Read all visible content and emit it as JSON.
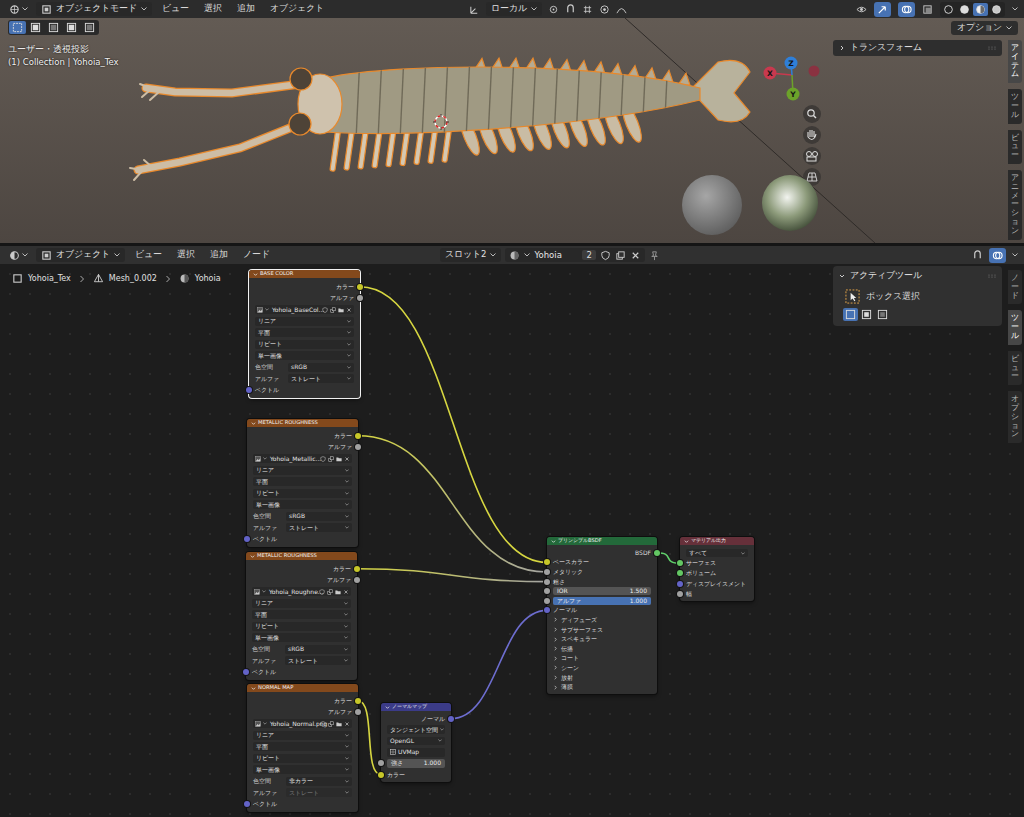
{
  "viewport_header": {
    "mode": "オブジェクトモード",
    "menus": [
      "ビュー",
      "選択",
      "追加",
      "オブジェクト"
    ],
    "orientation": "ローカル",
    "gizmos_on": true,
    "overlays_on": true,
    "shading_modes": [
      {
        "selected": false
      },
      {
        "selected": false
      },
      {
        "selected": true
      },
      {
        "selected": false
      }
    ]
  },
  "viewport": {
    "view_name": "ユーザー・透視投影",
    "collection": "(1) Collection | Yohoia_Tex",
    "options_button": "オプション",
    "select_modes": [
      {
        "selected": true
      },
      {
        "selected": false
      },
      {
        "selected": false
      },
      {
        "selected": false
      },
      {
        "selected": false
      }
    ],
    "transform_panel": {
      "title": "トランスフォーム",
      "expanded": false
    },
    "tabs": [
      {
        "label": "アイテム",
        "selected": true
      },
      {
        "label": "ツール",
        "selected": false
      },
      {
        "label": "ビュー",
        "selected": false
      },
      {
        "label": "アニメーション",
        "selected": false
      }
    ],
    "gizmo_axes": [
      {
        "label": "X",
        "color": "#c8394e"
      },
      {
        "label": "Y",
        "color": "#6ca22a"
      },
      {
        "label": "Z",
        "color": "#2f7fd8"
      }
    ]
  },
  "node_header": {
    "mode": "オブジェクト",
    "menus": [
      "ビュー",
      "選択",
      "追加",
      "ノード"
    ],
    "slot": "スロット2",
    "material": "Yohoia",
    "users": "2",
    "overlay_on": true
  },
  "breadcrumb": [
    "Yohoia_Tex",
    "Mesh_0.002",
    "Yohoia"
  ],
  "active_tool": {
    "title": "アクティブツール",
    "tool": "ボックス選択",
    "expanded": true,
    "modes": [
      {
        "selected": true
      },
      {
        "selected": false
      },
      {
        "selected": false
      }
    ]
  },
  "sidebar_tabs": [
    {
      "label": "ノード",
      "selected": false
    },
    {
      "label": "ツール",
      "selected": true
    },
    {
      "label": "ビュー",
      "selected": false
    },
    {
      "label": "オプション",
      "selected": false
    }
  ],
  "nodes": [
    {
      "title": "BASE COLOR",
      "kind": "image",
      "selected": true,
      "rows": [
        {
          "kind": "output",
          "label": "カラー",
          "socket": "color"
        },
        {
          "kind": "output",
          "label": "アルファ",
          "socket": "float"
        },
        {
          "kind": "image",
          "value": "Yohoia_BaseCol..."
        },
        {
          "kind": "dropdown",
          "value": "リニア",
          "disabled": false
        },
        {
          "kind": "dropdown",
          "value": "平面",
          "disabled": false
        },
        {
          "kind": "dropdown",
          "value": "リピート",
          "disabled": false
        },
        {
          "kind": "dropdown",
          "value": "単一画像",
          "disabled": false
        },
        {
          "kind": "dropdown",
          "label": "色空間",
          "value": "sRGB",
          "disabled": false
        },
        {
          "kind": "dropdown",
          "label": "アルファ",
          "value": "ストレート",
          "disabled": false
        },
        {
          "kind": "input",
          "label": "ベクトル",
          "socket": "vector"
        }
      ]
    },
    {
      "title": "METALLIC ROUGHNESS",
      "kind": "image",
      "selected": false,
      "rows": [
        {
          "kind": "output",
          "label": "カラー",
          "socket": "color"
        },
        {
          "kind": "output",
          "label": "アルファ",
          "socket": "float"
        },
        {
          "kind": "image",
          "value": "Yohoia_Metallic..."
        },
        {
          "kind": "dropdown",
          "value": "リニア",
          "disabled": false
        },
        {
          "kind": "dropdown",
          "value": "平面",
          "disabled": false
        },
        {
          "kind": "dropdown",
          "value": "リピート",
          "disabled": false
        },
        {
          "kind": "dropdown",
          "value": "単一画像",
          "disabled": false
        },
        {
          "kind": "dropdown",
          "label": "色空間",
          "value": "sRGB",
          "disabled": false
        },
        {
          "kind": "dropdown",
          "label": "アルファ",
          "value": "ストレート",
          "disabled": false
        },
        {
          "kind": "input",
          "label": "ベクトル",
          "socket": "vector"
        }
      ]
    },
    {
      "title": "METALLIC ROUGHNESS",
      "kind": "image",
      "selected": false,
      "rows": [
        {
          "kind": "output",
          "label": "カラー",
          "socket": "color"
        },
        {
          "kind": "output",
          "label": "アルファ",
          "socket": "float"
        },
        {
          "kind": "image",
          "value": "Yohoia_Roughne..."
        },
        {
          "kind": "dropdown",
          "value": "リニア",
          "disabled": false
        },
        {
          "kind": "dropdown",
          "value": "平面",
          "disabled": false
        },
        {
          "kind": "dropdown",
          "value": "リピート",
          "disabled": false
        },
        {
          "kind": "dropdown",
          "value": "単一画像",
          "disabled": false
        },
        {
          "kind": "dropdown",
          "label": "色空間",
          "value": "sRGB",
          "disabled": false
        },
        {
          "kind": "dropdown",
          "label": "アルファ",
          "value": "ストレート",
          "disabled": false
        },
        {
          "kind": "input",
          "label": "ベクトル",
          "socket": "vector"
        }
      ]
    },
    {
      "title": "NORMAL MAP",
      "kind": "image",
      "selected": false,
      "rows": [
        {
          "kind": "output",
          "label": "カラー",
          "socket": "color"
        },
        {
          "kind": "output",
          "label": "アルファ",
          "socket": "float"
        },
        {
          "kind": "image",
          "value": "Yohoia_Normal.png"
        },
        {
          "kind": "dropdown",
          "value": "リニア",
          "disabled": false
        },
        {
          "kind": "dropdown",
          "value": "平面",
          "disabled": false
        },
        {
          "kind": "dropdown",
          "value": "リピート",
          "disabled": false
        },
        {
          "kind": "dropdown",
          "value": "単一画像",
          "disabled": false
        },
        {
          "kind": "dropdown",
          "label": "色空間",
          "value": "非カラー",
          "disabled": false
        },
        {
          "kind": "dropdown",
          "label": "アルファ",
          "value": "ストレート",
          "disabled": true
        },
        {
          "kind": "input",
          "label": "ベクトル",
          "socket": "vector"
        }
      ]
    },
    {
      "title": "ノーマルマップ",
      "kind": "vector",
      "selected": false,
      "rows": [
        {
          "kind": "output",
          "label": "ノーマル",
          "socket": "vector"
        },
        {
          "kind": "dropdown",
          "value": "タンジェント空間",
          "disabled": false
        },
        {
          "kind": "dropdown",
          "value": "OpenGL",
          "disabled": false
        },
        {
          "kind": "uvmap",
          "value": "UVMap"
        },
        {
          "kind": "field",
          "label": "強さ",
          "value": "1.000",
          "socket": "float"
        },
        {
          "kind": "input",
          "label": "カラー",
          "socket": "color"
        }
      ]
    },
    {
      "title": "プリンシプルBSDF",
      "kind": "shader",
      "selected": false,
      "rows": [
        {
          "kind": "output",
          "label": "BSDF",
          "socket": "shader"
        },
        {
          "kind": "input",
          "label": "ベースカラー",
          "socket": "color"
        },
        {
          "kind": "input",
          "label": "メタリック",
          "socket": "float"
        },
        {
          "kind": "input",
          "label": "粗さ",
          "socket": "float"
        },
        {
          "kind": "field",
          "label": "IOR",
          "value": "1.500",
          "socket": "float"
        },
        {
          "kind": "slider",
          "label": "アルファ",
          "value": "1.000",
          "socket": "float",
          "level": 1
        },
        {
          "kind": "input",
          "label": "ノーマル",
          "socket": "vector"
        },
        {
          "kind": "panel",
          "label": "ディフューズ",
          "expanded": false
        },
        {
          "kind": "panel",
          "label": "サブサーフェス",
          "expanded": false
        },
        {
          "kind": "panel",
          "label": "スペキュラー",
          "expanded": false
        },
        {
          "kind": "panel",
          "label": "伝播",
          "expanded": false
        },
        {
          "kind": "panel",
          "label": "コート",
          "expanded": false
        },
        {
          "kind": "panel",
          "label": "シーン",
          "expanded": false
        },
        {
          "kind": "panel",
          "label": "放射",
          "expanded": false
        },
        {
          "kind": "panel",
          "label": "薄膜",
          "expanded": false
        }
      ]
    },
    {
      "title": "マテリアル出力",
      "kind": "output",
      "selected": false,
      "rows": [
        {
          "kind": "dropdown",
          "value": "すべて",
          "disabled": false
        },
        {
          "kind": "input",
          "label": "サーフェス",
          "socket": "shader"
        },
        {
          "kind": "input",
          "label": "ボリューム",
          "socket": "shader"
        },
        {
          "kind": "input",
          "label": "ディスプレイスメント",
          "socket": "vector"
        },
        {
          "kind": "input",
          "label": "幅",
          "socket": "float"
        }
      ]
    }
  ],
  "links": [
    {
      "from": [
        0,
        0
      ],
      "to": [
        5,
        1
      ]
    },
    {
      "from": [
        1,
        0
      ],
      "to": [
        5,
        2
      ]
    },
    {
      "from": [
        2,
        0
      ],
      "to": [
        5,
        3
      ]
    },
    {
      "from": [
        3,
        0
      ],
      "to": [
        4,
        5
      ]
    },
    {
      "from": [
        4,
        0
      ],
      "to": [
        5,
        6
      ]
    },
    {
      "from": [
        5,
        0
      ],
      "to": [
        6,
        1
      ]
    }
  ]
}
